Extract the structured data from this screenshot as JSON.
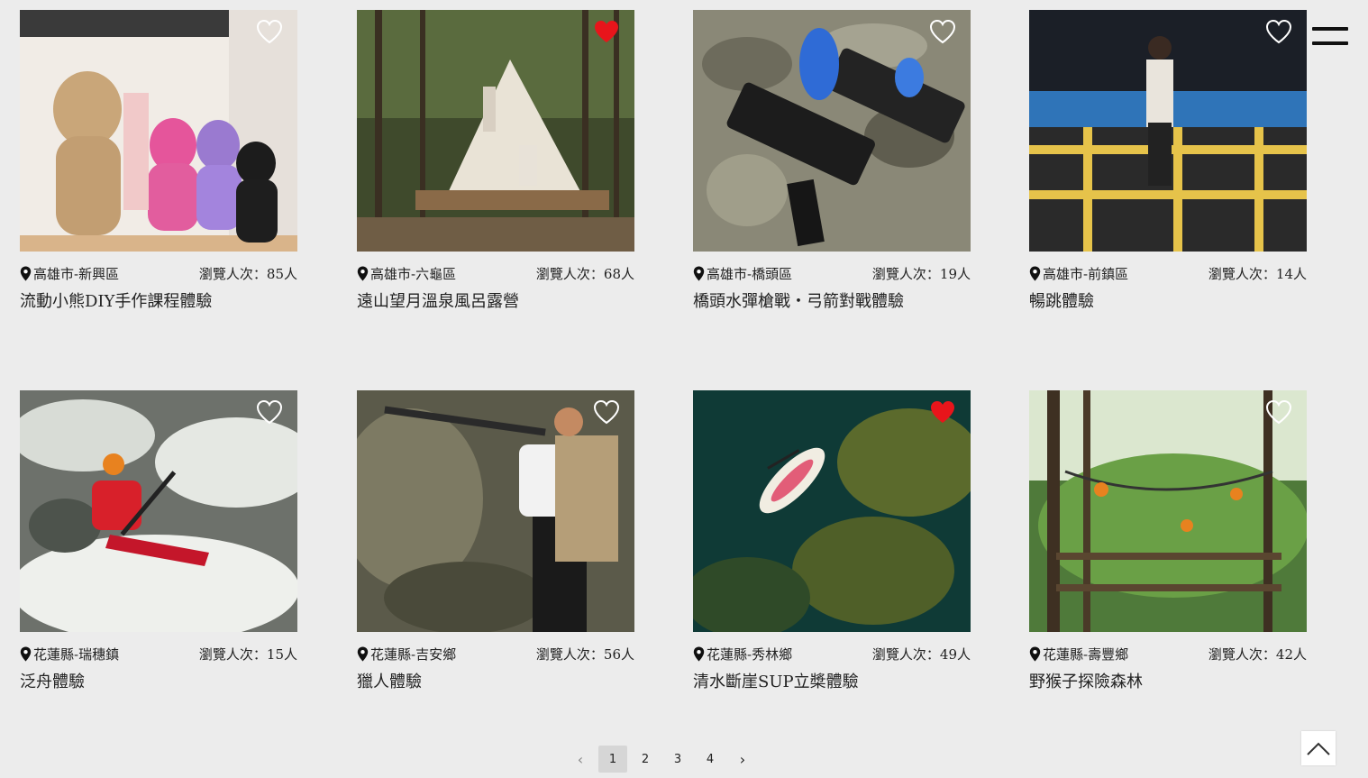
{
  "cards": [
    {
      "location": "高雄市-新興區",
      "views": "瀏覽人次：85人",
      "title": "流動小熊DIY手作課程體驗",
      "favorited": false,
      "image_desc": "bear-figurines-photo"
    },
    {
      "location": "高雄市-六龜區",
      "views": "瀏覽人次：68人",
      "title": "遠山望月溫泉風呂露營",
      "favorited": true,
      "image_desc": "forest-glamping-tent-photo"
    },
    {
      "location": "高雄市-橋頭區",
      "views": "瀏覽人次：19人",
      "title": "橋頭水彈槍戰・弓箭對戰體驗",
      "favorited": false,
      "image_desc": "gel-blaster-guns-photo"
    },
    {
      "location": "高雄市-前鎮區",
      "views": "瀏覽人次：14人",
      "title": "暢跳體驗",
      "favorited": false,
      "image_desc": "trampoline-park-photo"
    },
    {
      "location": "花蓮縣-瑞穗鎮",
      "views": "瀏覽人次：15人",
      "title": "泛舟體驗",
      "favorited": false,
      "image_desc": "whitewater-kayak-photo"
    },
    {
      "location": "花蓮縣-吉安鄉",
      "views": "瀏覽人次：56人",
      "title": "獵人體驗",
      "favorited": false,
      "image_desc": "hunter-with-rifle-photo"
    },
    {
      "location": "花蓮縣-秀林鄉",
      "views": "瀏覽人次：49人",
      "title": "清水斷崖SUP立槳體驗",
      "favorited": true,
      "image_desc": "sup-paddleboard-aerial-photo"
    },
    {
      "location": "花蓮縣-壽豐鄉",
      "views": "瀏覽人次：42人",
      "title": "野猴子探險森林",
      "favorited": false,
      "image_desc": "forest-rope-course-photo"
    }
  ],
  "pagination": {
    "prev": "‹",
    "pages": [
      "1",
      "2",
      "3",
      "4"
    ],
    "current": 1,
    "next": "›"
  },
  "colors": {
    "background": "#ececec",
    "heart_active": "#e8151b",
    "heart_outline": "#ffffff"
  },
  "icons": {
    "menu": "hamburger-menu-icon",
    "pin": "map-pin-icon",
    "heart": "heart-icon",
    "back_to_top": "chevron-up-icon"
  }
}
